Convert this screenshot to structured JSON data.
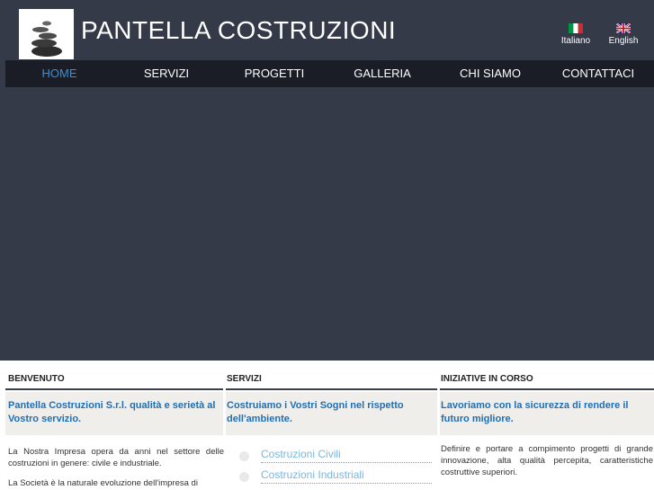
{
  "header": {
    "brand": "PANTELLA COSTRUZIONI",
    "languages": [
      {
        "label": "Italiano",
        "flag": "flag-it-icon"
      },
      {
        "label": "English",
        "flag": "flag-uk-icon"
      }
    ]
  },
  "nav": {
    "items": [
      "HOME",
      "SERVIZI",
      "PROGETTI",
      "GALLERIA",
      "CHI SIAMO",
      "CONTATTACI"
    ],
    "active": "HOME"
  },
  "columns": {
    "benvenuto": {
      "title": "BENVENUTO",
      "tagline": "Pantella Costruzioni S.r.l. qualità e serietà al Vostro servizio.",
      "para1": "La Nostra Impresa opera da anni nel settore delle costruzioni in genere: civile e industriale.",
      "para2": "La Società è la naturale evoluzione dell'impresa di"
    },
    "servizi": {
      "title": "SERVIZI",
      "tagline": "Costruiamo i Vostri Sogni nel rispetto dell'ambiente.",
      "items": [
        "Costruzioni Civili",
        "Costruzioni Industriali"
      ]
    },
    "iniziative": {
      "title": "INIZIATIVE IN CORSO",
      "tagline": "Lavoriamo con la sicurezza di rendere il futuro migliore.",
      "para1": "Definire e portare a compimento progetti di grande innovazione, alta qualità percepita, caratteristiche costruttive superiori."
    }
  },
  "colors": {
    "background": "#343a48",
    "nav_bg": "#1a1d25",
    "active_nav": "#3b8fd6",
    "tagline": "#1e6fb6"
  }
}
